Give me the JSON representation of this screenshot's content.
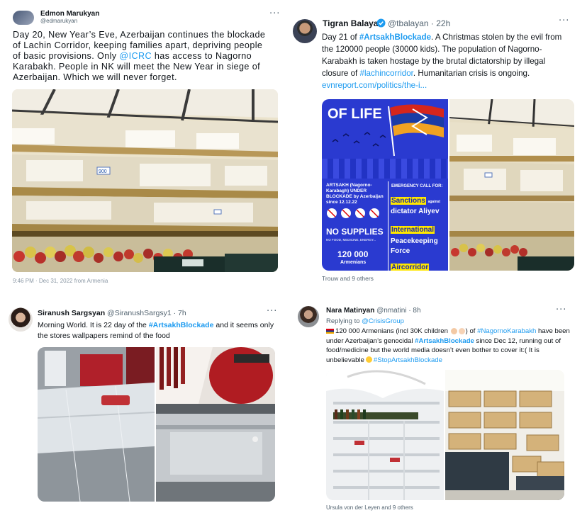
{
  "tweets": [
    {
      "name": "Edmon Marukyan",
      "handle": "@edmarukyan",
      "text_part1": "Day 20, New Year’s Eve, Azerbaijan continues the blockade of Lachin Corridor, keeping families apart, depriving people of basic provisions. Only ",
      "mention": "@ICRC",
      "text_part2": " has access to Nagorno Karabakh. People in NK will meet the New Year in siege of Azerbaijan. Which we will never forget.",
      "price_tag": "900",
      "timestamp": "9:46 PM · Dec 31, 2022 from Armenia",
      "more": "···"
    },
    {
      "name": "Tigran Balayan",
      "handle": "@tbalayan",
      "time": "· 22h",
      "text_part1": "Day 21 of ",
      "hashtag": "#ArtsakhBlockade",
      "text_part2": ". A Christmas stolen by the evil from the 120000 people (30000 kids). The population of Nagorno-Karabakh is taken hostage by the brutal dictatorship by illegal closure of ",
      "hashtag2": "#lachincorridor",
      "text_part3": ". Humanitarian crisis is ongoing.",
      "link": "evnreport.com/politics/the-i...",
      "likes": "Trouw and 9 others",
      "more": "···",
      "poster": {
        "title": "OF LIFE",
        "left_block": "ARTSAKH (Nagorno-Karabagh) UNDER BLOCKADE by Azerbaijan since 12.12.22",
        "no_supplies": "NO SUPPLIES",
        "no_supplies_sub": "NO FOOD, MEDICINE, ENERGY...",
        "count": "120 000",
        "count_sub": "Armenians",
        "emergency": "EMERGENCY CALL FOR:",
        "sanctions": "Sanctions",
        "against": "against",
        "dictator": "dictator Aliyev",
        "international": "International",
        "peacekeeping": "Peacekeeping",
        "force": "Force",
        "aircorridor": "Aircorridor"
      }
    },
    {
      "name": "Siranush Sargsyan",
      "handle": "@SiranushSargsy1",
      "time": "· 7h",
      "text_part1": "Morning World. It is 22 day  of the ",
      "hashtag": "#ArtsakhBlockade",
      "text_part2": " and it seems only the stores wallpapers remind of the food",
      "more": "···"
    },
    {
      "name": "Nara Matinyan",
      "handle": "@nmatini",
      "time": "· 8h",
      "replying": "Replying to ",
      "replying_to": "@CrisisGroup",
      "text_part1": "120 000 Armenians (incl 30K children ",
      "text_part2": ") of ",
      "hashtag": "#NagornoKarabakh",
      "text_part3": " have been under Azerbaijan’s genocidal ",
      "hashtag2": "#ArtsakhBlockade",
      "text_part4": " since Dec 12, running out of food/medicine but the world media doesn’t even bother to cover it:( It is unbelievable",
      "hashtag3": "#StopArtsakhBlockade",
      "likes": "Ursula von der Leyen and 9 others",
      "more": "···"
    }
  ],
  "colors": {
    "link": "#1d9bf0",
    "muted": "#536471",
    "poster_blue": "#2b3fd6",
    "poster_yellow": "#ffe600"
  }
}
